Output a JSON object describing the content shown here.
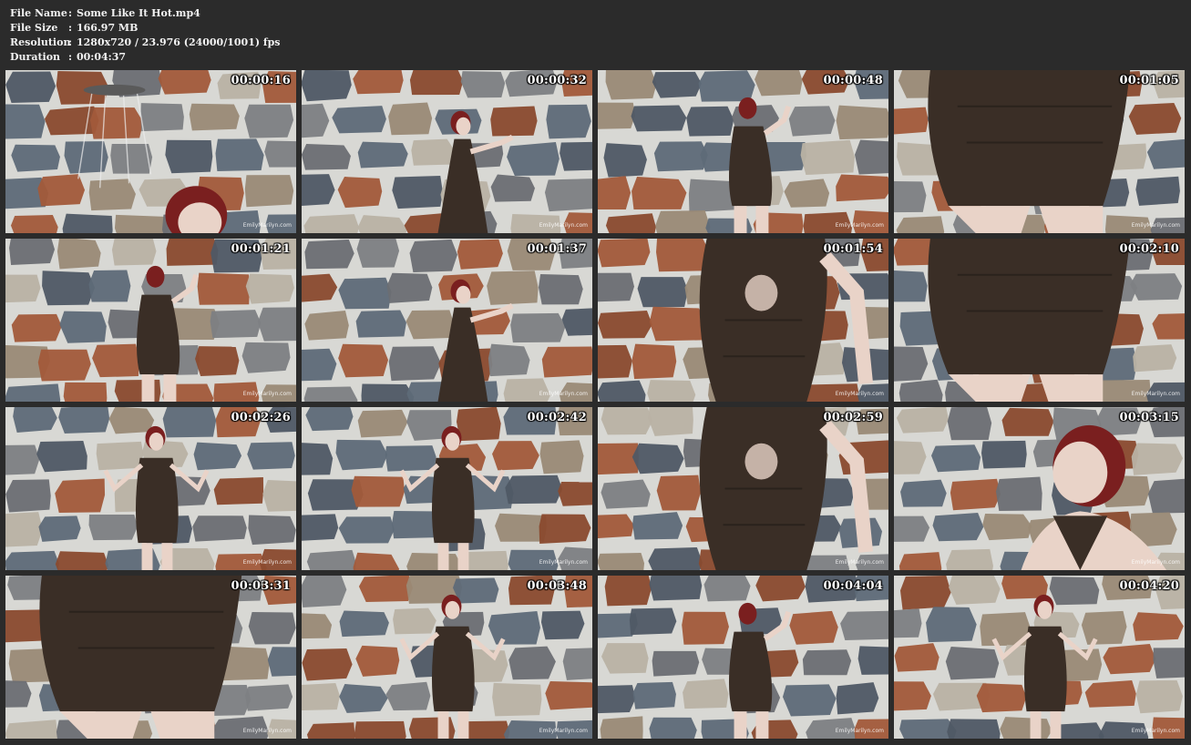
{
  "file_info": {
    "rows": [
      {
        "key": "File Name",
        "sep": ":",
        "value": "Some Like It Hot.mp4"
      },
      {
        "key": "File Size",
        "sep": ":",
        "value": "166.97 MB"
      },
      {
        "key": "Resolution",
        "sep": ":",
        "value": "1280x720 / 23.976 (24000/1001) fps"
      },
      {
        "key": "Duration",
        "sep": ":",
        "value": "00:04:37"
      }
    ]
  },
  "watermark": "EmilyMarilyn.com",
  "thumbnails": [
    {
      "timestamp": "00:00:16",
      "scene": "face-bottom"
    },
    {
      "timestamp": "00:00:32",
      "scene": "figure-leaning"
    },
    {
      "timestamp": "00:00:48",
      "scene": "figure-back"
    },
    {
      "timestamp": "00:01:05",
      "scene": "closeup-hips"
    },
    {
      "timestamp": "00:01:21",
      "scene": "figure-back"
    },
    {
      "timestamp": "00:01:37",
      "scene": "figure-leaning"
    },
    {
      "timestamp": "00:01:54",
      "scene": "closeup-torso"
    },
    {
      "timestamp": "00:02:10",
      "scene": "closeup-hips"
    },
    {
      "timestamp": "00:02:26",
      "scene": "figure-front"
    },
    {
      "timestamp": "00:02:42",
      "scene": "figure-front"
    },
    {
      "timestamp": "00:02:59",
      "scene": "closeup-torso"
    },
    {
      "timestamp": "00:03:15",
      "scene": "closeup-face"
    },
    {
      "timestamp": "00:03:31",
      "scene": "closeup-hips"
    },
    {
      "timestamp": "00:03:48",
      "scene": "figure-front"
    },
    {
      "timestamp": "00:04:04",
      "scene": "figure-back"
    },
    {
      "timestamp": "00:04:20",
      "scene": "figure-front"
    }
  ],
  "colors": {
    "background": "#2b2b2b",
    "text": "#f2f2f2",
    "stone_gray": "#7d7f83",
    "stone_rust": "#8a4a2e",
    "stone_slate": "#4f5865",
    "grout": "#d8d8d4",
    "dress": "#3a2e26",
    "hair": "#7a1f1f",
    "skin": "#e9d3c8"
  }
}
